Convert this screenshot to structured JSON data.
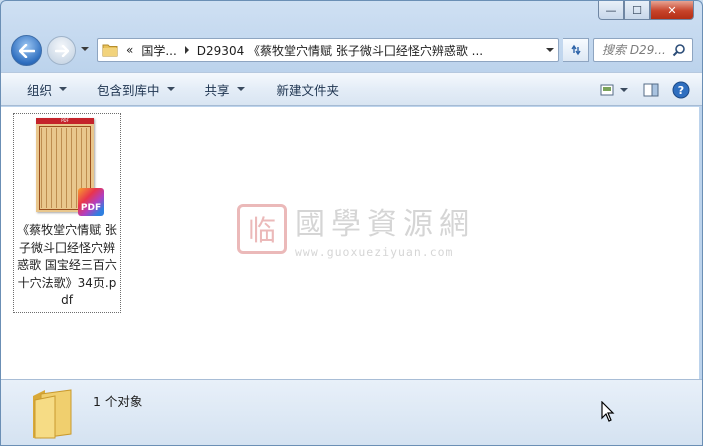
{
  "window": {
    "caption_buttons": {
      "minimize": "—",
      "maximize": "☐",
      "close": "✕"
    }
  },
  "address": {
    "overflow": "«",
    "crumbs": [
      "国学...",
      "D29304 《蔡牧堂穴情赋 张子微斗囗经怪穴辨惑歌 ..."
    ]
  },
  "search": {
    "placeholder": "搜索 D29..."
  },
  "toolbar": {
    "organize": "组织",
    "include_library": "包含到库中",
    "share": "共享",
    "new_folder": "新建文件夹"
  },
  "file": {
    "thumb_band": "PDF",
    "badge": "PDF",
    "name": "《蔡牧堂穴情赋 张子微斗囗经怪穴辨惑歌 国宝经三百六十穴法歌》34页.pdf"
  },
  "watermark": {
    "seal": "临",
    "title": "國學資源網",
    "url": "www.guoxueziyuan.com"
  },
  "status": {
    "count": "1 个对象"
  },
  "colors": {
    "accent": "#2f6fc0",
    "close": "#c7432a",
    "pdf_red": "#c4232b"
  }
}
